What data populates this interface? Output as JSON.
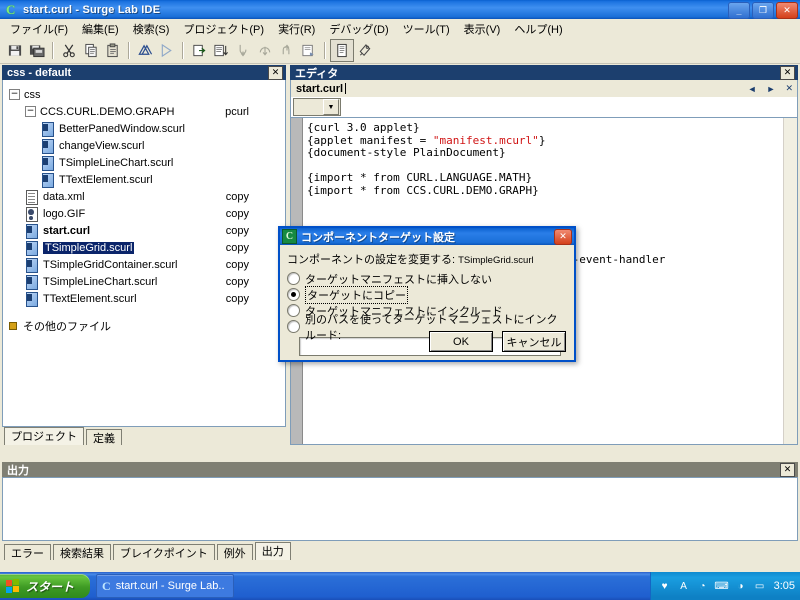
{
  "window": {
    "title": "start.curl - Surge Lab IDE",
    "icon": "curl-logo-icon",
    "minimize": "_",
    "maximize": "❐",
    "close": "✕"
  },
  "menubar": {
    "items": [
      {
        "label": "ファイル(F)",
        "name": "menu-file"
      },
      {
        "label": "編集(E)",
        "name": "menu-edit"
      },
      {
        "label": "検索(S)",
        "name": "menu-search"
      },
      {
        "label": "プロジェクト(P)",
        "name": "menu-project"
      },
      {
        "label": "実行(R)",
        "name": "menu-run"
      },
      {
        "label": "デバッグ(D)",
        "name": "menu-debug"
      },
      {
        "label": "ツール(T)",
        "name": "menu-tools"
      },
      {
        "label": "表示(V)",
        "name": "menu-view"
      },
      {
        "label": "ヘルプ(H)",
        "name": "menu-help"
      }
    ]
  },
  "toolbar": {
    "buttons": [
      {
        "name": "save-icon"
      },
      {
        "name": "save-all-icon"
      },
      {
        "name": "cut-icon"
      },
      {
        "name": "copy-icon"
      },
      {
        "name": "paste-icon"
      },
      {
        "name": "build-icon"
      },
      {
        "name": "run-icon"
      },
      {
        "name": "debug-start-icon"
      },
      {
        "name": "debug-list-icon"
      },
      {
        "name": "step-into-icon"
      },
      {
        "name": "step-over-icon"
      },
      {
        "name": "step-out-icon"
      },
      {
        "name": "run-to-cursor-icon"
      },
      {
        "name": "document-icon"
      },
      {
        "name": "settings-icon"
      }
    ]
  },
  "project_panel": {
    "caption": "css - default",
    "close_label": "✕",
    "tree": [
      {
        "depth": 0,
        "type": "folder",
        "expander": "−",
        "label": "css",
        "kind": "",
        "bold": false,
        "selected": false
      },
      {
        "depth": 1,
        "type": "folder",
        "expander": "−",
        "label": "CCS.CURL.DEMO.GRAPH",
        "kind": "pcurl",
        "bold": false,
        "selected": false
      },
      {
        "depth": 2,
        "type": "curl",
        "label": "BetterPanedWindow.scurl",
        "kind": "",
        "bold": false,
        "selected": false
      },
      {
        "depth": 2,
        "type": "curl",
        "label": "changeView.scurl",
        "kind": "",
        "bold": false,
        "selected": false
      },
      {
        "depth": 2,
        "type": "curl",
        "label": "TSimpleLineChart.scurl",
        "kind": "",
        "bold": false,
        "selected": false
      },
      {
        "depth": 2,
        "type": "curl",
        "label": "TTextElement.scurl",
        "kind": "",
        "bold": false,
        "selected": false
      },
      {
        "depth": 1,
        "type": "xml",
        "label": "data.xml",
        "kind": "copy",
        "bold": false,
        "selected": false
      },
      {
        "depth": 1,
        "type": "gif",
        "label": "logo.GIF",
        "kind": "copy",
        "bold": false,
        "selected": false
      },
      {
        "depth": 1,
        "type": "curl",
        "label": "start.curl",
        "kind": "copy",
        "bold": true,
        "selected": false
      },
      {
        "depth": 1,
        "type": "curl",
        "label": "TSimpleGrid.scurl",
        "kind": "copy",
        "bold": false,
        "selected": true
      },
      {
        "depth": 1,
        "type": "curl",
        "label": "TSimpleGridContainer.scurl",
        "kind": "copy",
        "bold": false,
        "selected": false
      },
      {
        "depth": 1,
        "type": "curl",
        "label": "TSimpleLineChart.scurl",
        "kind": "copy",
        "bold": false,
        "selected": false
      },
      {
        "depth": 1,
        "type": "curl",
        "label": "TTextElement.scurl",
        "kind": "copy",
        "bold": false,
        "selected": false
      },
      {
        "depth": 0,
        "type": "bullet",
        "label": "その他のファイル",
        "kind": "",
        "bold": false,
        "selected": false
      }
    ],
    "tabs": [
      {
        "label": "プロジェクト",
        "active": true,
        "name": "tab-project"
      },
      {
        "label": "定義",
        "active": false,
        "name": "tab-definition"
      }
    ]
  },
  "editor_panel": {
    "caption": "エディタ",
    "close_label": "✕",
    "tab": "start.curl",
    "nav_prev": "◄",
    "nav_next": "►",
    "nav_close": "✕",
    "combo_arrow": "▼",
    "code_lines": [
      {
        "text": "{curl 3.0 applet}",
        "cls": ""
      },
      {
        "text": "{applet manifest = ",
        "cls": "",
        "str": "\"manifest.mcurl\"",
        "tail": "}"
      },
      {
        "text": "{document-style PlainDocument}",
        "cls": ""
      },
      {
        "text": "",
        "cls": ""
      },
      {
        "text": "{import * from CURL.LANGUAGE.MATH}",
        "cls": ""
      },
      {
        "text": "{import * from CCS.CURL.DEMO.GRAPH}",
        "cls": ""
      },
      {
        "text": "",
        "cls": ""
      },
      {
        "text": "",
        "cls": ""
      }
    ],
    "visible_fragment": "aphic.add-event-handler",
    "closing_brace": "}"
  },
  "output_panel": {
    "caption": "出力",
    "close_label": "✕",
    "tabs": [
      {
        "label": "エラー",
        "active": false,
        "name": "tab-errors"
      },
      {
        "label": "検索結果",
        "active": false,
        "name": "tab-search-results"
      },
      {
        "label": "ブレイクポイント",
        "active": false,
        "name": "tab-breakpoints"
      },
      {
        "label": "例外",
        "active": false,
        "name": "tab-exceptions"
      },
      {
        "label": "出力",
        "active": true,
        "name": "tab-output"
      }
    ]
  },
  "dialog": {
    "title": "コンポーネントターゲット設定",
    "icon": "curl-logo-icon",
    "close_label": "✕",
    "subtitle": "コンポーネントの設定を変更する:",
    "subject_file": "TSimpleGrid.scurl",
    "options": [
      {
        "label": "ターゲットマニフェストに挿入しない",
        "selected": false,
        "focused": false,
        "name": "radio-no-insert"
      },
      {
        "label": "ターゲットにコピー",
        "selected": true,
        "focused": true,
        "name": "radio-copy-to-target"
      },
      {
        "label": "ターゲットマニフェストにインクルード",
        "selected": false,
        "focused": false,
        "name": "radio-include-in-manifest"
      },
      {
        "label": "別のパスを使ってターゲットマニフェストにインクルード:",
        "selected": false,
        "focused": false,
        "name": "radio-include-alt-path"
      }
    ],
    "path_value": "",
    "ok_label": "OK",
    "cancel_label": "キャンセル"
  },
  "taskbar": {
    "start_label": "スタート",
    "tasks": [
      {
        "label": "start.curl - Surge Lab..",
        "icon": "curl-logo-icon",
        "name": "taskbar-task-surgelab"
      }
    ],
    "tray": [
      {
        "name": "volume-icon",
        "glyph": "♥"
      },
      {
        "name": "ime-indicator-icon",
        "glyph": "A"
      },
      {
        "name": "clock-tray-icon",
        "glyph": "◔"
      },
      {
        "name": "network-icon",
        "glyph": "⌨"
      },
      {
        "name": "speaker-icon",
        "glyph": "◑"
      },
      {
        "name": "monitor-icon",
        "glyph": "▭"
      }
    ],
    "clock": "3:05"
  }
}
